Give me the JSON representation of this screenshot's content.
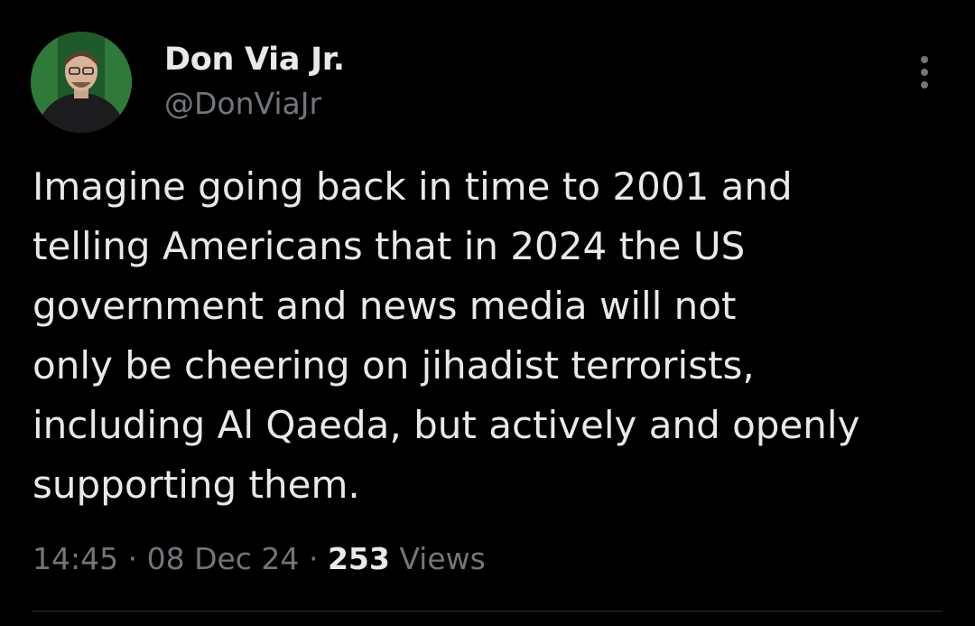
{
  "author": {
    "display_name": "Don Via Jr.",
    "handle": "@DonViaJr",
    "avatar_icon": "user-avatar-photo"
  },
  "tweet": {
    "text": "Imagine going back in time to 2001 and\ntelling Americans that in 2024 the US\ngovernment and news media will not\nonly be cheering on jihadist terrorists,\nincluding Al Qaeda, but actively and openly\nsupporting them.",
    "time": "14:45",
    "separator": "·",
    "date": "08 Dec 24",
    "views_count": "253",
    "views_label": "Views"
  },
  "menu": {
    "icon": "more-options-icon"
  },
  "colors": {
    "background": "#000000",
    "primary_text": "#e7e9ea",
    "secondary_text": "#71767b"
  }
}
